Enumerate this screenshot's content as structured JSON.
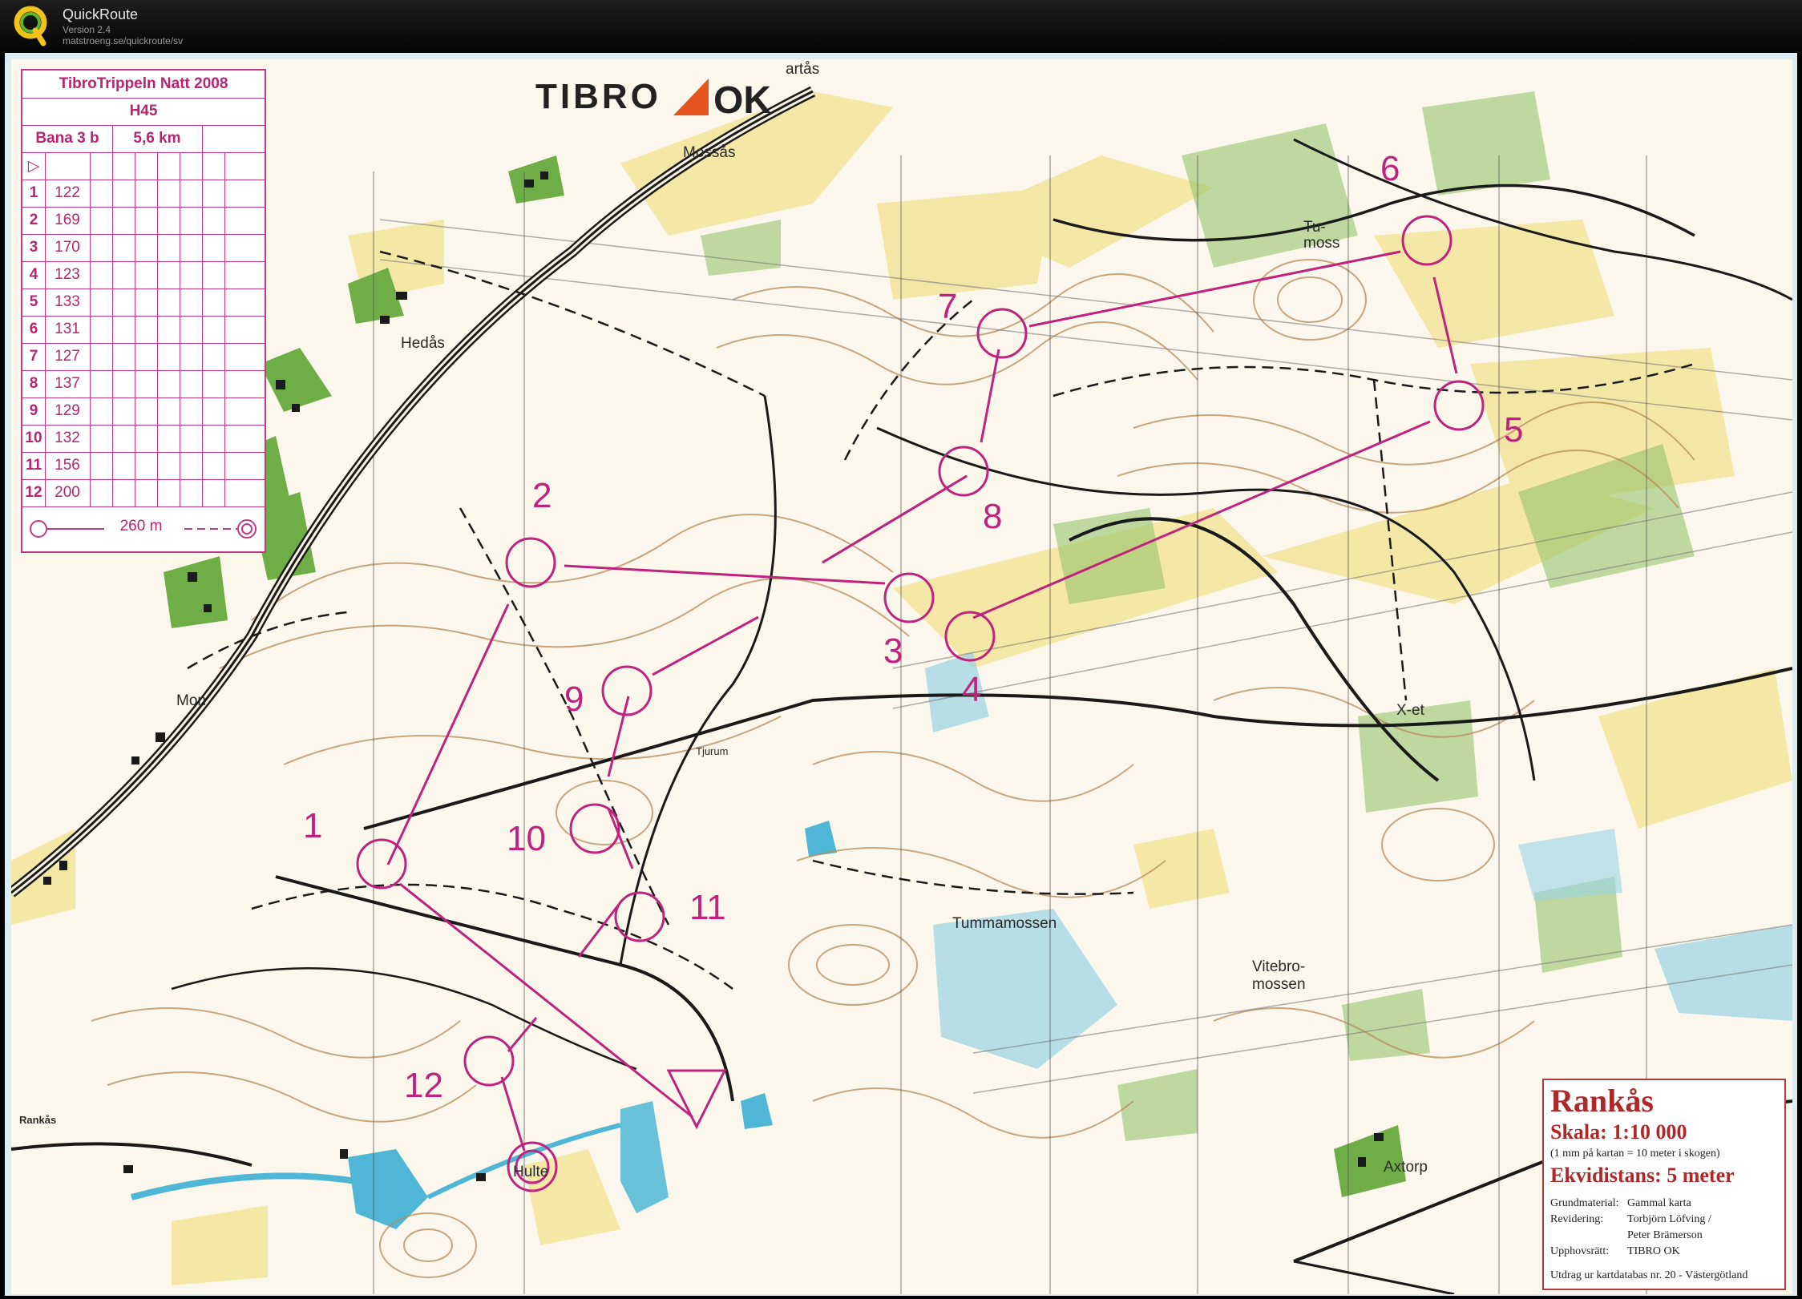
{
  "app": {
    "name": "QuickRoute",
    "version": "Version 2.4",
    "url": "matstroeng.se/quickroute/sv"
  },
  "club_logo": {
    "text_left": "TIBRO",
    "text_right": "OK"
  },
  "course_card": {
    "event": "TibroTrippeln Natt 2008",
    "class": "H45",
    "course": "Bana 3 b",
    "length": "5,6 km",
    "controls": [
      {
        "num": "1",
        "code": "122"
      },
      {
        "num": "2",
        "code": "169"
      },
      {
        "num": "3",
        "code": "170"
      },
      {
        "num": "4",
        "code": "123"
      },
      {
        "num": "5",
        "code": "133"
      },
      {
        "num": "6",
        "code": "131"
      },
      {
        "num": "7",
        "code": "127"
      },
      {
        "num": "8",
        "code": "137"
      },
      {
        "num": "9",
        "code": "129"
      },
      {
        "num": "10",
        "code": "132"
      },
      {
        "num": "11",
        "code": "156"
      },
      {
        "num": "12",
        "code": "200"
      }
    ],
    "finish_distance": "260 m"
  },
  "place_labels": {
    "hedas": "Hedås",
    "mossas": "Mossås",
    "partas": "artås",
    "mon": "Mon",
    "tumoss": "Tu-\nmoss",
    "tjurum": "Tjurum",
    "xet": "X-et",
    "tummamossen": "Tummamossen",
    "vitebromossen": "Vitebro-\nmossen",
    "rankas_small": "Rankås",
    "hulte": "Hulte",
    "axtorp": "Axtorp"
  },
  "control_labels": [
    "1",
    "2",
    "3",
    "4",
    "5",
    "6",
    "7",
    "8",
    "9",
    "10",
    "11",
    "12"
  ],
  "legend": {
    "map_name": "Rankås",
    "scale": "Skala:  1:10 000",
    "scale_note": "(1 mm på kartan = 10 meter i skogen)",
    "contour": "Ekvidistans:  5 meter",
    "base_key": "Grundmaterial:",
    "base_val": "Gammal karta",
    "rev_key": "Revidering:",
    "rev_val": "Torbjörn Löfving /",
    "rev_val2": "Peter Brämerson",
    "copy_key": "Upphovsrätt:",
    "copy_val": "TIBRO OK",
    "extract": "Utdrag ur kartdatabas nr. 20 - Västergötland"
  },
  "colors": {
    "course": "#c0237d",
    "road": "#1a1a1a",
    "contour": "#b98a5a",
    "open": "#f3e49a",
    "green": "#8cc063",
    "water": "#4fb6d6",
    "marsh": "#9ad3e6"
  }
}
